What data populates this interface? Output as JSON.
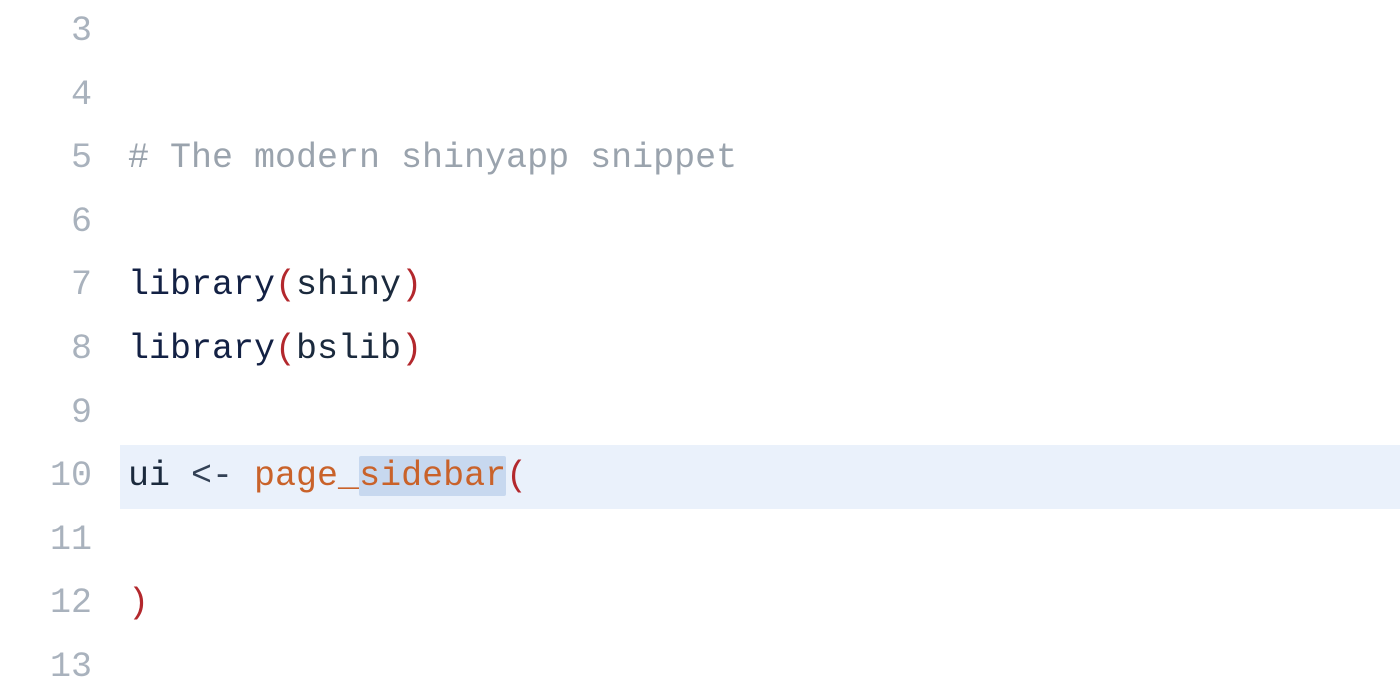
{
  "lines": [
    {
      "num": "3",
      "highlighted": false,
      "tokens": []
    },
    {
      "num": "4",
      "highlighted": false,
      "tokens": []
    },
    {
      "num": "5",
      "highlighted": false,
      "tokens": [
        {
          "cls": "tok-comment",
          "text": "# The modern shinyapp snippet"
        }
      ]
    },
    {
      "num": "6",
      "highlighted": false,
      "tokens": []
    },
    {
      "num": "7",
      "highlighted": false,
      "tokens": [
        {
          "cls": "tok-ident-dark",
          "text": "library"
        },
        {
          "cls": "tok-paren",
          "text": "("
        },
        {
          "cls": "tok-ident-dark2",
          "text": "shiny"
        },
        {
          "cls": "tok-paren",
          "text": ")"
        }
      ]
    },
    {
      "num": "8",
      "highlighted": false,
      "tokens": [
        {
          "cls": "tok-ident-dark",
          "text": "library"
        },
        {
          "cls": "tok-paren",
          "text": "("
        },
        {
          "cls": "tok-ident-dark2",
          "text": "bslib"
        },
        {
          "cls": "tok-paren",
          "text": ")"
        }
      ]
    },
    {
      "num": "9",
      "highlighted": false,
      "tokens": []
    },
    {
      "num": "10",
      "highlighted": true,
      "tokens": [
        {
          "cls": "tok-ident-dark2",
          "text": "ui "
        },
        {
          "cls": "tok-op",
          "text": "<-"
        },
        {
          "cls": "",
          "text": " "
        },
        {
          "cls": "tok-func",
          "text": "page_"
        },
        {
          "cls": "tok-func sel",
          "text": "sidebar"
        },
        {
          "cls": "tok-paren",
          "text": "("
        }
      ]
    },
    {
      "num": "11",
      "highlighted": false,
      "tokens": []
    },
    {
      "num": "12",
      "highlighted": false,
      "tokens": [
        {
          "cls": "tok-paren",
          "text": ")"
        }
      ]
    },
    {
      "num": "13",
      "highlighted": false,
      "tokens": []
    }
  ]
}
